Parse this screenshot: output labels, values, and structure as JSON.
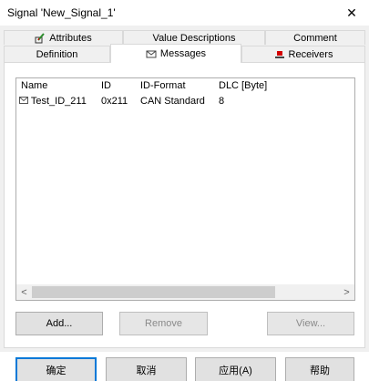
{
  "window": {
    "title": "Signal 'New_Signal_1'",
    "close_glyph": "✕"
  },
  "tabs": {
    "row_top": [
      {
        "label": "Attributes",
        "icon": "attributes-icon"
      },
      {
        "label": "Value Descriptions"
      },
      {
        "label": "Comment"
      }
    ],
    "row_bottom": [
      {
        "label": "Definition"
      },
      {
        "label": "Messages",
        "icon": "envelope-icon",
        "active": true
      },
      {
        "label": "Receivers",
        "icon": "receivers-icon"
      }
    ]
  },
  "list": {
    "columns": [
      "Name",
      "ID",
      "ID-Format",
      "DLC [Byte]"
    ],
    "rows": [
      {
        "name": "Test_ID_211",
        "id": "0x211",
        "id_format": "CAN Standard",
        "dlc": "8"
      }
    ],
    "scroll_left": "<",
    "scroll_right": ">"
  },
  "buttons": {
    "add": "Add...",
    "remove": "Remove",
    "view": "View..."
  },
  "footer": {
    "ok": "确定",
    "cancel": "取消",
    "apply": "应用(A)",
    "help": "帮助"
  },
  "colors": {
    "accent": "#0078d7",
    "dialog_bg": "#f0f0f0",
    "receivers_icon": "#d40000"
  }
}
